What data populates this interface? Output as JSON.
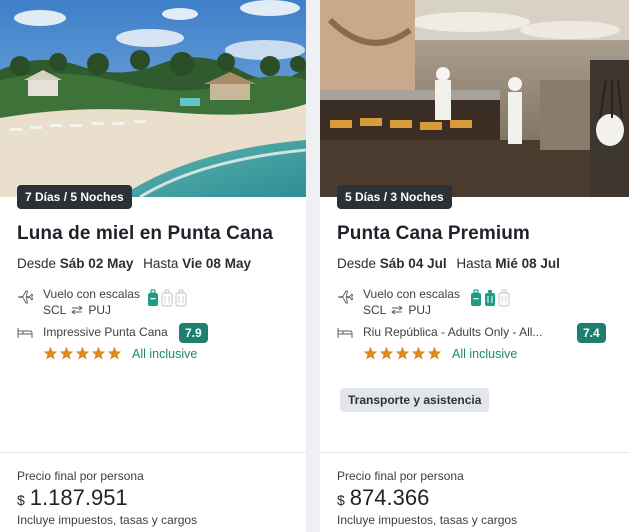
{
  "cards": [
    {
      "duration": "7 Días / 5 Noches",
      "title": "Luna de miel en Punta Cana",
      "dates": {
        "from_label": "Desde",
        "from": "Sáb 02 May",
        "to_label": "Hasta",
        "to": "Vie 08 May"
      },
      "flight": {
        "label": "Vuelo con escalas",
        "origin": "SCL",
        "destination": "PUJ"
      },
      "hotel": {
        "name": "Impressive Punta Cana",
        "score": "7.9",
        "stars": 5,
        "regime": "All inclusive"
      },
      "price": {
        "label": "Precio final por persona",
        "currency": "$",
        "amount": "1.187.951",
        "note": "Incluye impuestos, tasas y cargos"
      }
    },
    {
      "duration": "5 Días / 3 Noches",
      "title": "Punta Cana Premium",
      "dates": {
        "from_label": "Desde",
        "from": "Sáb 04 Jul",
        "to_label": "Hasta",
        "to": "Mié 08 Jul"
      },
      "flight": {
        "label": "Vuelo con escalas",
        "origin": "SCL",
        "destination": "PUJ"
      },
      "hotel": {
        "name": "Riu República - Adults Only - All...",
        "score": "7.4",
        "stars": 5,
        "regime": "All inclusive"
      },
      "service": "Transporte y asistencia",
      "price": {
        "label": "Precio final por persona",
        "currency": "$",
        "amount": "874.366",
        "note": "Incluye impuestos, tasas y cargos"
      }
    }
  ],
  "colors": {
    "score_bg": "#1f7f6f",
    "star": "#e08a1e",
    "regime": "#1b8a74",
    "bag_active": "#1f9c84",
    "bag_inactive": "#c9cdd2"
  },
  "icons": [
    "plane-icon",
    "swap-arrows-icon",
    "carry-on-bag-icon",
    "checked-bag-icon",
    "bed-icon",
    "star-icon"
  ]
}
